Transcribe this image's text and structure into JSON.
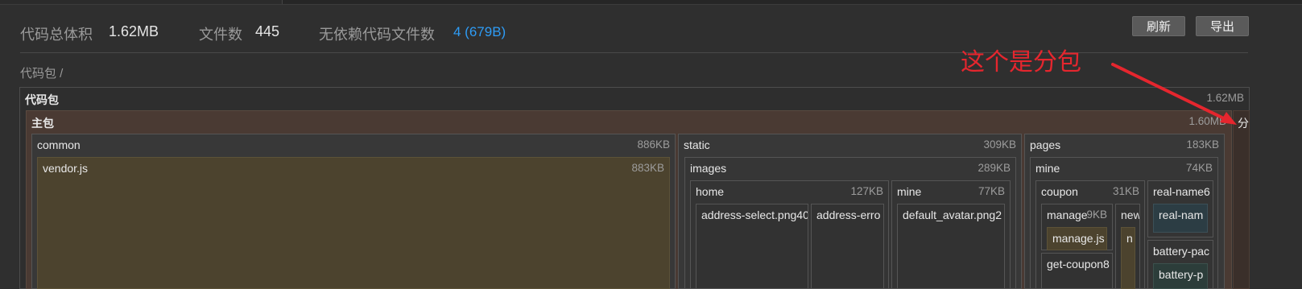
{
  "stats": {
    "total_size_label": "代码总体积",
    "total_size_value": "1.62MB",
    "file_count_label": "文件数",
    "file_count_value": "445",
    "no_dep_label": "无依赖代码文件数",
    "no_dep_value": "4 (679B)"
  },
  "toolbar": {
    "refresh_label": "刷新",
    "export_label": "导出"
  },
  "breadcrumb": {
    "text": "代码包 /"
  },
  "annotation": {
    "text": "这个是分包"
  },
  "treemap": {
    "root": {
      "name": "代码包",
      "size": "1.62MB"
    },
    "main": {
      "name": "主包",
      "size": "1.60MB",
      "cut_text": "分"
    },
    "common": {
      "name": "common",
      "size": "886KB"
    },
    "vendor": {
      "name": "vendor.js",
      "size": "883KB"
    },
    "static": {
      "name": "static",
      "size": "309KB"
    },
    "images": {
      "name": "images",
      "size": "289KB"
    },
    "home": {
      "name": "home",
      "size": "127KB"
    },
    "address_select": {
      "name": "address-select.png40"
    },
    "address_error": {
      "name": "address-erro"
    },
    "static_mine": {
      "name": "mine",
      "size": "77KB"
    },
    "default_avatar": {
      "name": "default_avatar.png2"
    },
    "pages": {
      "name": "pages",
      "size": "183KB"
    },
    "pages_mine": {
      "name": "mine",
      "size": "74KB"
    },
    "coupon": {
      "name": "coupon",
      "size": "31KB"
    },
    "manage": {
      "name": "manage",
      "size": "9KB"
    },
    "manage_js": {
      "name": "manage.js"
    },
    "new": {
      "name": "new"
    },
    "new_child": {
      "name": "n"
    },
    "get_coupon": {
      "name": "get-coupon8"
    },
    "real_name": {
      "name": "real-name6"
    },
    "real_name_child": {
      "name": "real-nam"
    },
    "battery": {
      "name": "battery-pac"
    },
    "battery_child": {
      "name": "battery-p"
    }
  },
  "colors": {
    "main_bg": "#4a3a33",
    "vendor_bg": "#4c432e",
    "accent_blue": "#2e9cf5",
    "annotation_red": "#e5262e"
  }
}
